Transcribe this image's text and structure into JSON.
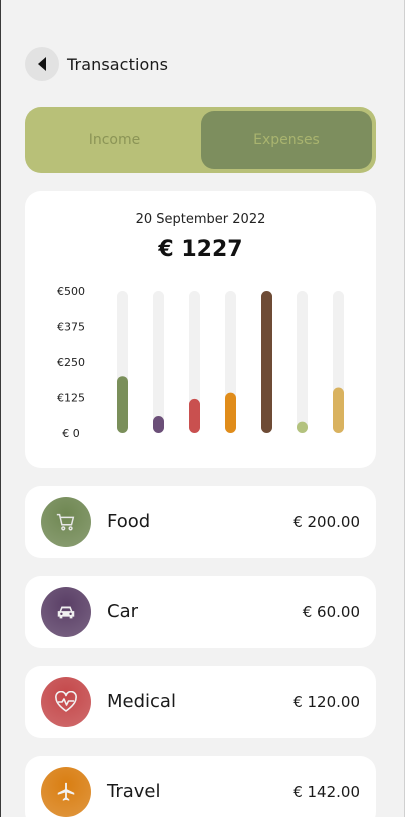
{
  "header": {
    "title": "Transactions"
  },
  "tabs": [
    {
      "label": "Income",
      "active": false
    },
    {
      "label": "Expenses",
      "active": true
    }
  ],
  "summary": {
    "date": "20 September 2022",
    "total": "€ 1227"
  },
  "chart_data": {
    "type": "bar",
    "ytick_labels": [
      "€500",
      "€375",
      "€250",
      "€125",
      "€ 0"
    ],
    "ylim": [
      0,
      500
    ],
    "values": [
      200,
      60,
      120,
      142,
      500,
      40,
      160
    ],
    "colors": [
      "#7a8f5a",
      "#6b4f78",
      "#c9504f",
      "#e08c1a",
      "#6e4b35",
      "#b3c27e",
      "#d9b25f"
    ],
    "track_color": "#f1f1f1"
  },
  "transactions": [
    {
      "name": "Food",
      "amount": "€ 200.00",
      "icon": "cart-icon",
      "color": "#6f8752"
    },
    {
      "name": "Car",
      "amount": "€ 60.00",
      "icon": "car-icon",
      "color": "#5a3f66"
    },
    {
      "name": "Medical",
      "amount": "€ 120.00",
      "icon": "heartbeat-icon",
      "color": "#c4484a"
    },
    {
      "name": "Travel",
      "amount": "€ 142.00",
      "icon": "airplane-icon",
      "color": "#d97e12"
    }
  ]
}
